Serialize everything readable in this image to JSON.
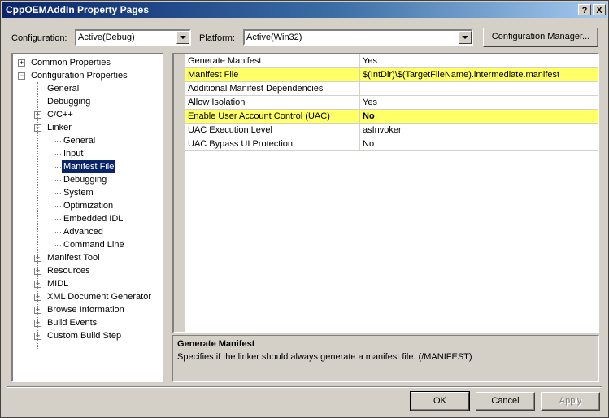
{
  "window": {
    "title": "CppOEMAddIn Property Pages"
  },
  "titlebar_buttons": {
    "help": "?",
    "close": "X"
  },
  "top": {
    "configuration_label": "Configuration:",
    "configuration_value": "Active(Debug)",
    "platform_label": "Platform:",
    "platform_value": "Active(Win32)",
    "config_manager_label": "Configuration Manager..."
  },
  "tree": [
    {
      "label": "Common Properties",
      "level": 0,
      "expander": "+"
    },
    {
      "label": "Configuration Properties",
      "level": 0,
      "expander": "-"
    },
    {
      "label": "General",
      "level": 1,
      "expander": ""
    },
    {
      "label": "Debugging",
      "level": 1,
      "expander": ""
    },
    {
      "label": "C/C++",
      "level": 1,
      "expander": "+"
    },
    {
      "label": "Linker",
      "level": 1,
      "expander": "-"
    },
    {
      "label": "General",
      "level": 2,
      "expander": ""
    },
    {
      "label": "Input",
      "level": 2,
      "expander": ""
    },
    {
      "label": "Manifest File",
      "level": 2,
      "expander": "",
      "selected": true
    },
    {
      "label": "Debugging",
      "level": 2,
      "expander": ""
    },
    {
      "label": "System",
      "level": 2,
      "expander": ""
    },
    {
      "label": "Optimization",
      "level": 2,
      "expander": ""
    },
    {
      "label": "Embedded IDL",
      "level": 2,
      "expander": ""
    },
    {
      "label": "Advanced",
      "level": 2,
      "expander": ""
    },
    {
      "label": "Command Line",
      "level": 2,
      "expander": ""
    },
    {
      "label": "Manifest Tool",
      "level": 1,
      "expander": "+"
    },
    {
      "label": "Resources",
      "level": 1,
      "expander": "+"
    },
    {
      "label": "MIDL",
      "level": 1,
      "expander": "+"
    },
    {
      "label": "XML Document Generator",
      "level": 1,
      "expander": "+"
    },
    {
      "label": "Browse Information",
      "level": 1,
      "expander": "+"
    },
    {
      "label": "Build Events",
      "level": 1,
      "expander": "+"
    },
    {
      "label": "Custom Build Step",
      "level": 1,
      "expander": "+"
    }
  ],
  "properties": [
    {
      "name": "Generate Manifest",
      "value": "Yes",
      "highlight": false,
      "bold": false
    },
    {
      "name": "Manifest File",
      "value": "$(IntDir)\\$(TargetFileName).intermediate.manifest",
      "highlight": true,
      "bold": false
    },
    {
      "name": "Additional Manifest Dependencies",
      "value": "",
      "highlight": false,
      "bold": false
    },
    {
      "name": "Allow Isolation",
      "value": "Yes",
      "highlight": false,
      "bold": false
    },
    {
      "name": "Enable User Account Control (UAC)",
      "value": "No",
      "highlight": true,
      "bold": true
    },
    {
      "name": "UAC Execution Level",
      "value": "asInvoker",
      "highlight": false,
      "bold": false
    },
    {
      "name": "UAC Bypass UI Protection",
      "value": "No",
      "highlight": false,
      "bold": false
    }
  ],
  "description": {
    "title": "Generate Manifest",
    "text": "Specifies if the linker should always generate a manifest file.      (/MANIFEST)"
  },
  "buttons": {
    "ok": "OK",
    "cancel": "Cancel",
    "apply": "Apply"
  },
  "colors": {
    "title_active": "#0a246a",
    "highlight_row": "#ffff66",
    "face": "#d4d0c8"
  }
}
